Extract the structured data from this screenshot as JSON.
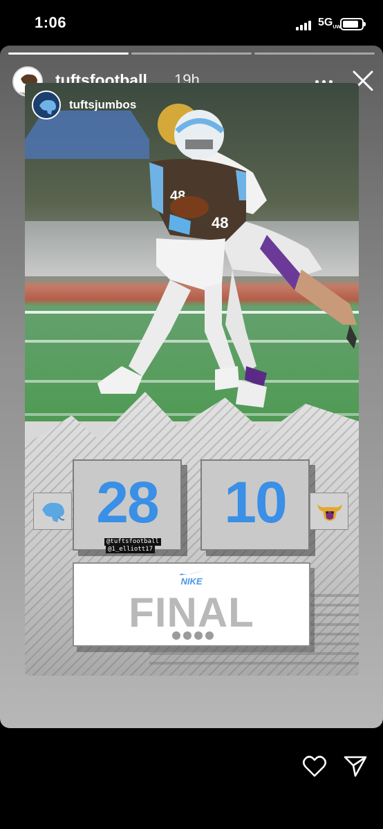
{
  "status_bar": {
    "time": "1:06",
    "network": "5G",
    "network_sub": "UW"
  },
  "story": {
    "progress_segments": 3,
    "progress_active": 1,
    "username": "tuftsfootball",
    "posted_ago": "19h",
    "mention": "tuftsjumbos",
    "avatar_caption": "FOOTBALL"
  },
  "graphic": {
    "home_score": "28",
    "away_score": "10",
    "tags": [
      "@tuftsfootball",
      "@1_elliott17"
    ],
    "sponsor": "NIKE",
    "status_text": "FINAL",
    "jersey_number": "48"
  },
  "colors": {
    "score_blue": "#3a8fe6",
    "tufts_brown": "#4b3a2c",
    "jersey_blue": "#6fb3e6",
    "opponent_purple": "#5b2a86",
    "opponent_gold": "#e2a92c"
  },
  "icons": {
    "more": "more-horizontal-icon",
    "close": "close-icon",
    "like": "heart-icon",
    "share": "send-icon"
  }
}
